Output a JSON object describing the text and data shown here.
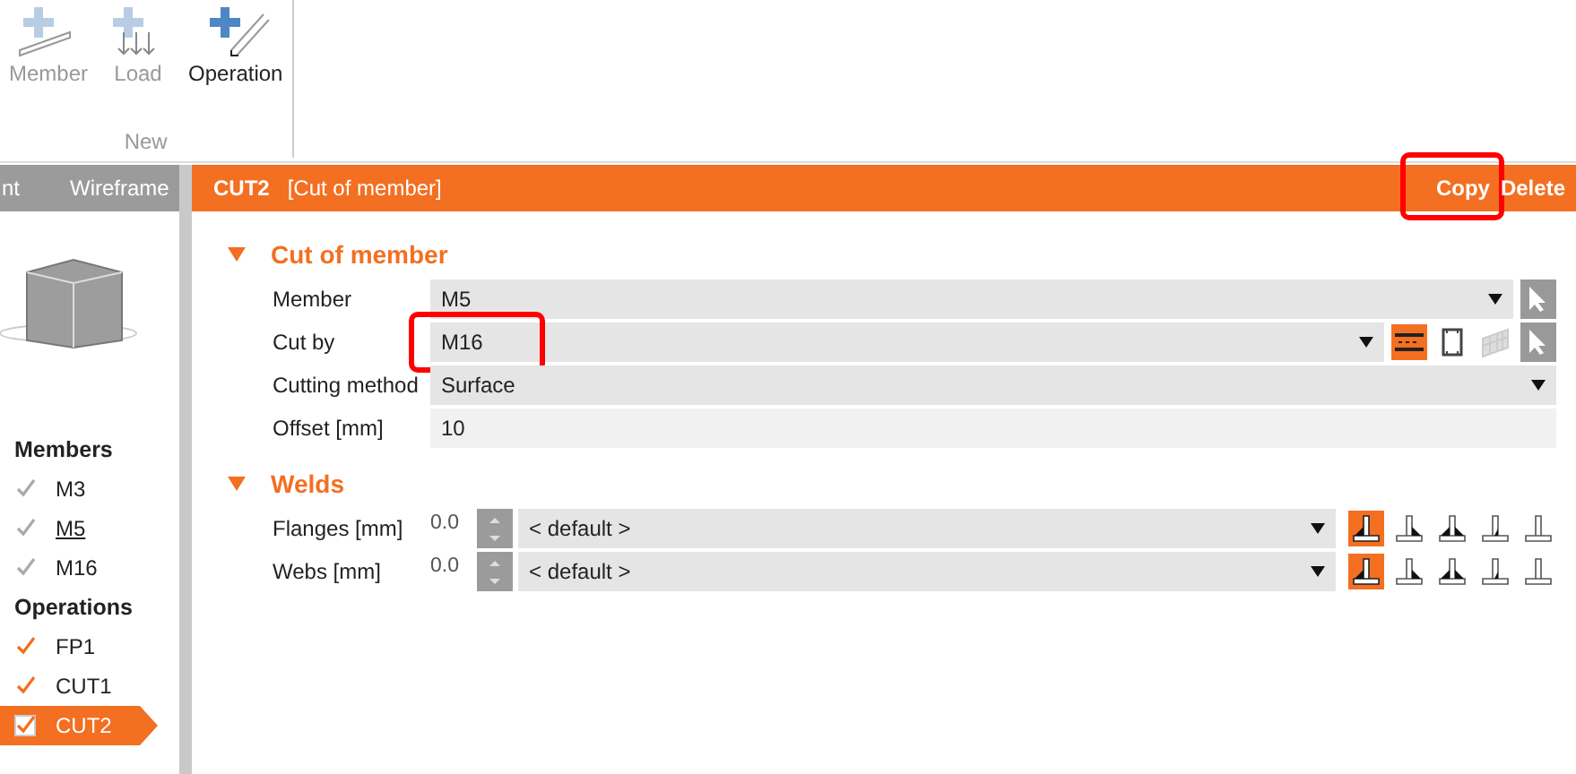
{
  "ribbon": {
    "buttons": [
      {
        "kind": "member",
        "label": "Member",
        "disabled": true
      },
      {
        "kind": "load",
        "label": "Load",
        "disabled": true
      },
      {
        "kind": "operation",
        "label": "Operation",
        "disabled": false
      }
    ],
    "group_label": "New"
  },
  "view_tabs": [
    "nt",
    "Wireframe"
  ],
  "tree": [
    {
      "label": "Members",
      "children": [
        {
          "label": "M3",
          "checked": true,
          "disabled": true,
          "underlined": false,
          "selected": false
        },
        {
          "label": "M5",
          "checked": true,
          "disabled": true,
          "underlined": true,
          "selected": false
        },
        {
          "label": "M16",
          "checked": true,
          "disabled": true,
          "underlined": false,
          "selected": false
        }
      ]
    },
    {
      "label": "Operations",
      "children": [
        {
          "label": "FP1",
          "checked": true,
          "disabled": false,
          "underlined": false,
          "selected": false
        },
        {
          "label": "CUT1",
          "checked": true,
          "disabled": false,
          "underlined": false,
          "selected": false
        },
        {
          "label": "CUT2",
          "checked": true,
          "disabled": false,
          "underlined": false,
          "selected": true
        }
      ]
    }
  ],
  "header": {
    "name": "CUT2",
    "type": "[Cut of member]",
    "actions": [
      {
        "label": "Copy",
        "highlighted": true
      },
      {
        "label": "Delete"
      }
    ]
  },
  "sections": [
    {
      "title": "Cut of member",
      "expanded": true,
      "rows": [
        {
          "kind": "select",
          "label": "Member",
          "value": "M5",
          "picker": true,
          "highlighted": false
        },
        {
          "kind": "select",
          "label": "Cut by",
          "value": "M16",
          "picker": true,
          "highlighted": true,
          "modes": [
            {
              "kind": "member",
              "selected": true
            },
            {
              "kind": "frame",
              "selected": false
            },
            {
              "kind": "plate",
              "selected": false
            }
          ]
        },
        {
          "kind": "select",
          "label": "Cutting method",
          "value": "Surface",
          "picker": false,
          "highlighted": false
        },
        {
          "kind": "input",
          "label": "Offset [mm]",
          "value": "10"
        }
      ]
    },
    {
      "title": "Welds",
      "expanded": true,
      "rows": [
        {
          "kind": "weld",
          "label": "Flanges [mm]",
          "thickness": "0.0",
          "value": "< default >",
          "welds": [
            {
              "kind": "left",
              "selected": true
            },
            {
              "kind": "right",
              "selected": false
            },
            {
              "kind": "double",
              "selected": false
            },
            {
              "kind": "inner",
              "selected": false
            },
            {
              "kind": "none",
              "selected": false
            }
          ]
        },
        {
          "kind": "weld",
          "label": "Webs [mm]",
          "thickness": "0.0",
          "value": "< default >",
          "welds": [
            {
              "kind": "left",
              "selected": true
            },
            {
              "kind": "right",
              "selected": false
            },
            {
              "kind": "double",
              "selected": false
            },
            {
              "kind": "inner",
              "selected": false
            },
            {
              "kind": "none",
              "selected": false
            }
          ]
        }
      ]
    }
  ]
}
